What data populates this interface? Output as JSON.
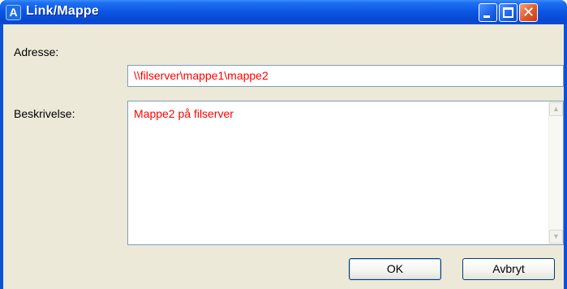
{
  "window": {
    "title": "Link/Mappe",
    "icon": "app-logo-icon",
    "icon_letter": "A",
    "minimize_icon": "minimize-icon",
    "maximize_icon": "maximize-icon",
    "close_icon": "close-icon",
    "close_glyph": "✕"
  },
  "form": {
    "address_label": "Adresse:",
    "address_value": "\\\\filserver\\mappe1\\mappe2",
    "description_label": "Beskrivelse:",
    "description_value": "Mappe2 på filserver",
    "scroll_up_glyph": "▲",
    "scroll_down_glyph": "▼"
  },
  "buttons": {
    "ok_label": "OK",
    "cancel_label": "Avbryt"
  },
  "colors": {
    "titlebar": "#0a55e3",
    "field_text": "#ff0000",
    "dialog_bg": "#ece9d8"
  }
}
